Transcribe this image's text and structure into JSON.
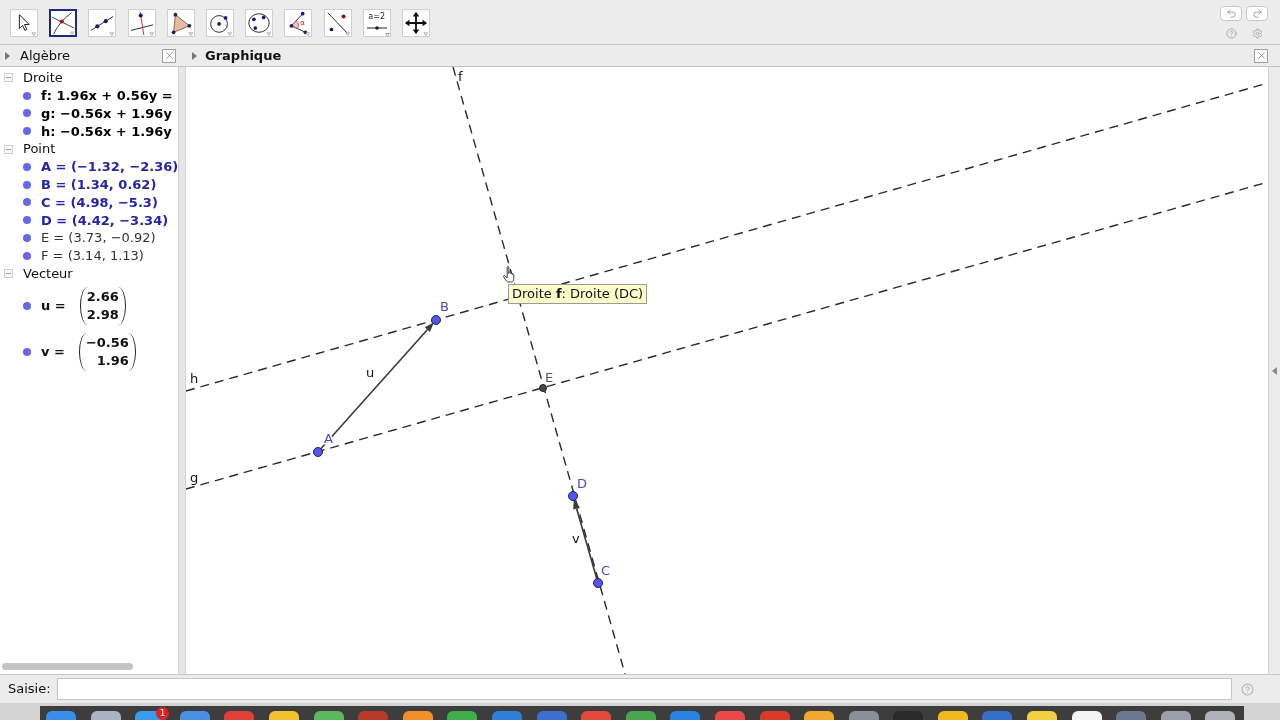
{
  "toolbar": {
    "tools": [
      {
        "kind": "move",
        "selected": false
      },
      {
        "kind": "intersect",
        "selected": true
      },
      {
        "kind": "line",
        "selected": false
      },
      {
        "kind": "perpendicular",
        "selected": false
      },
      {
        "kind": "polygon",
        "selected": false
      },
      {
        "kind": "circle",
        "selected": false
      },
      {
        "kind": "conic",
        "selected": false
      },
      {
        "kind": "angle",
        "selected": false,
        "label": "α"
      },
      {
        "kind": "reflect",
        "selected": false
      },
      {
        "kind": "slider",
        "selected": false,
        "label": "a=2"
      },
      {
        "kind": "move_view",
        "selected": false
      }
    ]
  },
  "algebra": {
    "title": "Algèbre",
    "groups": [
      {
        "kind": "line",
        "title": "Droite",
        "expanded": true,
        "items": [
          {
            "text": "f: 1.96x + 0.56y ="
          },
          {
            "text": "g: −0.56x + 1.96y"
          },
          {
            "text": "h: −0.56x + 1.96y"
          }
        ]
      },
      {
        "kind": "point",
        "title": "Point",
        "expanded": true,
        "items": [
          {
            "text": "A = (−1.32, −2.36)",
            "free": true
          },
          {
            "text": "B = (1.34, 0.62)",
            "free": true
          },
          {
            "text": "C = (4.98, −5.3)",
            "free": true
          },
          {
            "text": "D = (4.42, −3.34)",
            "free": true
          },
          {
            "text": "E = (3.73, −0.92)",
            "free": false
          },
          {
            "text": "F = (3.14, 1.13)",
            "free": false
          }
        ]
      },
      {
        "kind": "vector",
        "title": "Vecteur",
        "expanded": true,
        "items": [
          {
            "name": "u =",
            "components": [
              "2.66",
              "2.98"
            ]
          },
          {
            "name": "v =",
            "components": [
              "−0.56",
              "1.96"
            ]
          }
        ]
      }
    ]
  },
  "graphics": {
    "title": "Graphique",
    "lines": [
      {
        "label": "f"
      },
      {
        "label": "h"
      },
      {
        "label": "g"
      }
    ],
    "vectors": [
      {
        "label": "u"
      },
      {
        "label": "v"
      }
    ],
    "points": [
      {
        "label": "A",
        "free": true
      },
      {
        "label": "B",
        "free": true
      },
      {
        "label": "C",
        "free": true
      },
      {
        "label": "D",
        "free": true
      },
      {
        "label": "E",
        "free": false
      }
    ],
    "tooltip": "Droite **f**: Droite (DC)"
  },
  "input_bar": {
    "label": "Saisie:"
  },
  "dock": {
    "badge": "1"
  }
}
